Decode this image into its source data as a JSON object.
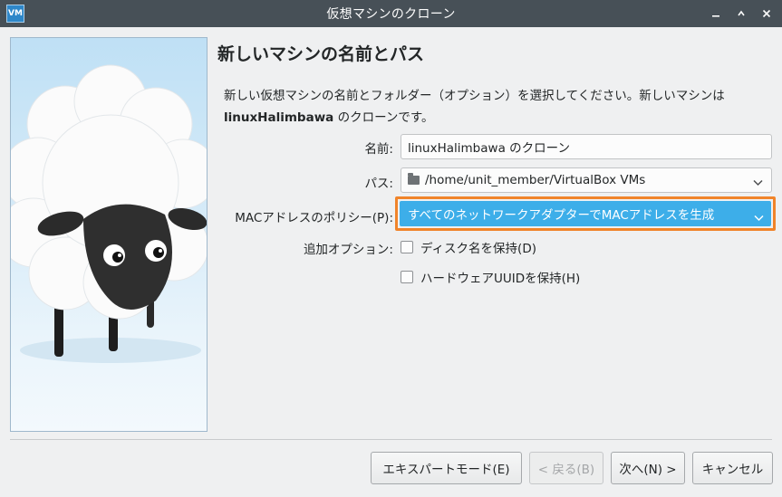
{
  "window": {
    "title": "仮想マシンのクローン",
    "app_icon_text": "VM",
    "controls": [
      "minimize-icon",
      "restore-icon",
      "close-icon"
    ]
  },
  "page": {
    "title": "新しいマシンの名前とパス",
    "description_part1": "新しい仮想マシンの名前とフォルダー（オプション）を選択してください。新しいマシンは ",
    "description_bold": "linuxHalimbawa",
    "description_part2": " のクローンです。"
  },
  "form": {
    "name_label": "名前:",
    "name_value": "linuxHalimbawa のクローン",
    "path_label": "パス:",
    "path_value": "/home/unit_member/VirtualBox VMs",
    "mac_label": "MACアドレスのポリシー(P):",
    "mac_value": "すべてのネットワークアダプターでMACアドレスを生成",
    "options_label": "追加オプション:",
    "keep_disk_names_label": "ディスク名を保持(D)",
    "keep_disk_names_checked": false,
    "keep_hw_uuid_label": "ハードウェアUUIDを保持(H)",
    "keep_hw_uuid_checked": false
  },
  "buttons": {
    "expert_mode": "エキスパートモード(E)",
    "back": "< 戻る(B)",
    "next": "次へ(N) >",
    "cancel": "キャンセル"
  },
  "colors": {
    "titlebar": "#475057",
    "selection": "#3daee9",
    "highlight_border": "#f0842a"
  }
}
